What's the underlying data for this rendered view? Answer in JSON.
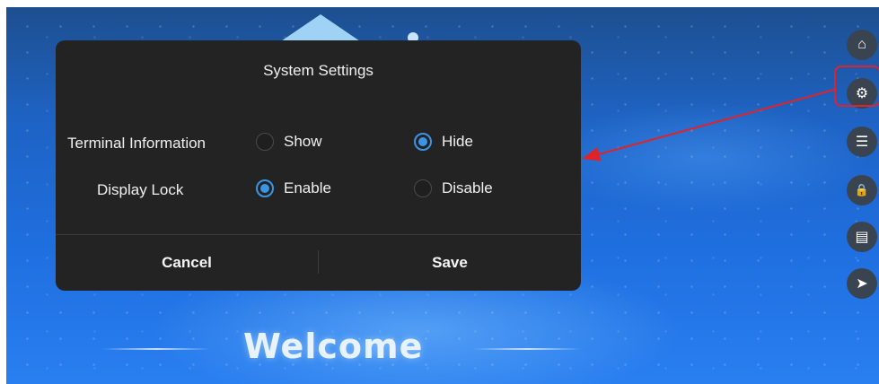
{
  "dialog": {
    "title": "System Settings",
    "rows": [
      {
        "label": "Terminal Information",
        "options": [
          {
            "label": "Show",
            "selected": false
          },
          {
            "label": "Hide",
            "selected": true
          }
        ]
      },
      {
        "label": "Display Lock",
        "options": [
          {
            "label": "Enable",
            "selected": true
          },
          {
            "label": "Disable",
            "selected": false
          }
        ]
      }
    ],
    "cancel_label": "Cancel",
    "save_label": "Save"
  },
  "welcome": {
    "text": "Welcome"
  },
  "sidebar": {
    "items": [
      {
        "icon": "home-icon",
        "glyph": "⌂"
      },
      {
        "icon": "gear-icon",
        "glyph": "⚙",
        "highlighted": true
      },
      {
        "icon": "server-icon",
        "glyph": "☰"
      },
      {
        "icon": "lock-icon",
        "glyph": "🔒"
      },
      {
        "icon": "document-icon",
        "glyph": "▤"
      },
      {
        "icon": "send-icon",
        "glyph": "➤"
      }
    ]
  },
  "colors": {
    "accent": "#3b94e6",
    "dialog_bg": "#232323",
    "annotation": "#e0232a"
  }
}
